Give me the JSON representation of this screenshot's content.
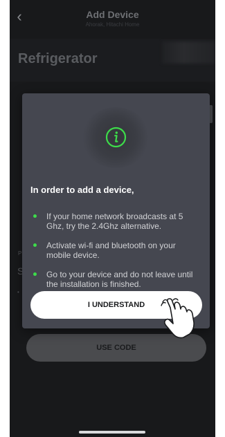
{
  "header": {
    "back_icon": "chevron-left-icon",
    "title": "Add Device",
    "subtitle": "Ahorak, Hitachi Home"
  },
  "page": {
    "heading": "Refrigerator",
    "background_fragments": [
      "P",
      "S",
      "•"
    ]
  },
  "modal": {
    "icon": "info-icon",
    "heading": "In order to add a device,",
    "tips": [
      "If your home network broadcasts at 5 Ghz, try the 2.4Ghz alternative.",
      "Activate wi-fi and bluetooth on your mobile device.",
      "Go to your device and do not leave until the installation is finished."
    ],
    "confirm_label": "I UNDERSTAND"
  },
  "footer": {
    "use_code_label": "USE CODE"
  },
  "overlay": {
    "pointer_icon": "hand-pointer-icon"
  },
  "colors": {
    "accent_green": "#3ddc4a",
    "modal_bg": "#454750",
    "screen_bg": "#18191b"
  }
}
